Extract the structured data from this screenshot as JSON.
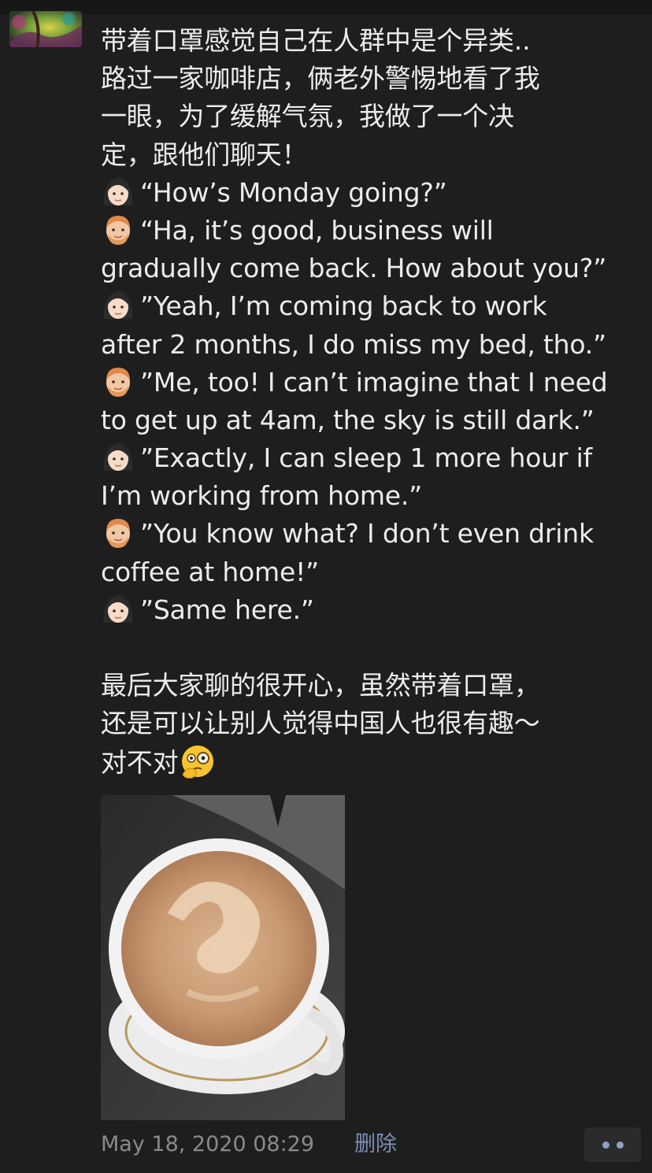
{
  "post": {
    "lines": [
      "带着口罩感觉自己在人群中是个异类..",
      "路过一家咖啡店，俩老外警惕地看了我",
      "一眼，为了缓解气氛，我做了一个决",
      "定，跟他们聊天！",
      "“How’s Monday going?”",
      "“Ha, it’s good, business will",
      "gradually come back. How about you?”",
      "”Yeah, I’m coming back to work",
      "after 2 months, I do miss my bed, tho.”",
      "”Me, too! I can’t imagine that I need",
      "to get up at 4am, the sky is still dark.”",
      "”Exactly, I can sleep 1 more hour if",
      "I’m working from home.”",
      "”You know what? I don’t even drink",
      "coffee at home!”",
      "”Same here.”",
      "",
      "最后大家聊的很开心，虽然带着口罩，",
      "还是可以让别人觉得中国人也很有趣～",
      "对不对"
    ],
    "emoji_icons": {
      "woman": "woman-face-icon",
      "man": "man-face-icon",
      "thinking": "face-with-monocle-icon"
    },
    "timestamp": "May 18, 2020 08:29",
    "delete_label": "删除"
  },
  "colors": {
    "background": "#1e1e1e",
    "text": "#ececec",
    "timestamp": "#8a8a8a",
    "link": "#7d8fb3"
  }
}
